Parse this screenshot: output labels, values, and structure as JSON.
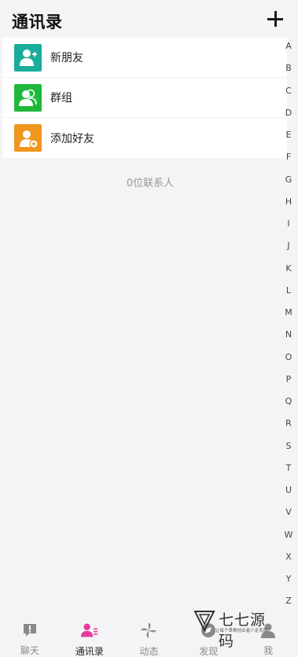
{
  "header": {
    "title": "通讯录",
    "add_icon": "plus-icon"
  },
  "menu": [
    {
      "label": "新朋友",
      "icon": "new-friend-icon",
      "color": "#1aad9c"
    },
    {
      "label": "群组",
      "icon": "group-icon",
      "color": "#20b83c"
    },
    {
      "label": "添加好友",
      "icon": "add-friend-icon",
      "color": "#f0951e"
    }
  ],
  "contact_count": "0位联系人",
  "index_letters": [
    "A",
    "B",
    "C",
    "D",
    "E",
    "F",
    "G",
    "H",
    "I",
    "J",
    "K",
    "L",
    "M",
    "N",
    "O",
    "P",
    "Q",
    "R",
    "S",
    "T",
    "U",
    "V",
    "W",
    "X",
    "Y",
    "Z"
  ],
  "tabs": [
    {
      "label": "聊天",
      "icon": "chat-icon",
      "active": false
    },
    {
      "label": "通讯录",
      "icon": "contacts-icon",
      "active": true
    },
    {
      "label": "动态",
      "icon": "pinwheel-icon",
      "active": false
    },
    {
      "label": "发现",
      "icon": "discover-icon",
      "active": false
    },
    {
      "label": "我",
      "icon": "me-icon",
      "active": false
    }
  ],
  "colors": {
    "active_tab": "#e63b9e",
    "inactive_tab": "#8a8a8a"
  },
  "watermark": {
    "title": "七七源码",
    "subtitle": "让每个草根创业者少走弯路"
  }
}
